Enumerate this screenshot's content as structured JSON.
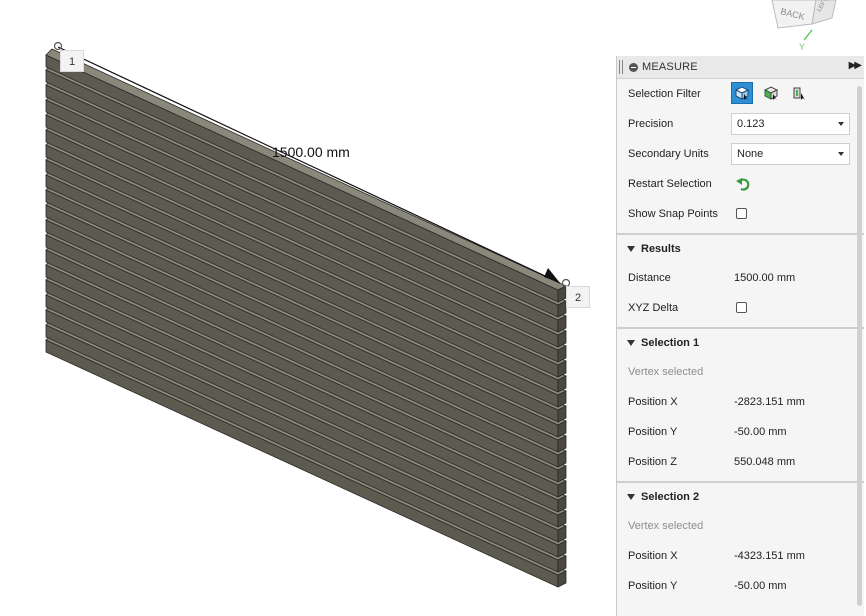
{
  "viewport": {
    "dimension_text": "1500.00 mm",
    "point1_label": "1",
    "point2_label": "2",
    "viewcube_back": "BACK",
    "viewcube_left": "LEFT",
    "axis_y": "Y"
  },
  "panel": {
    "title": "MEASURE",
    "selection_filter": {
      "label": "Selection Filter"
    },
    "precision": {
      "label": "Precision",
      "value": "0.123"
    },
    "secondary_units": {
      "label": "Secondary Units",
      "value": "None"
    },
    "restart_selection": {
      "label": "Restart Selection"
    },
    "show_snap_points": {
      "label": "Show Snap Points",
      "checked": false
    },
    "results": {
      "title": "Results",
      "distance_label": "Distance",
      "distance_value": "1500.00 mm",
      "xyz_delta_label": "XYZ Delta"
    },
    "selection1": {
      "title": "Selection 1",
      "status": "Vertex selected",
      "pos_x_label": "Position X",
      "pos_x": "-2823.151 mm",
      "pos_y_label": "Position Y",
      "pos_y": "-50.00 mm",
      "pos_z_label": "Position Z",
      "pos_z": "550.048 mm"
    },
    "selection2": {
      "title": "Selection 2",
      "status": "Vertex selected",
      "pos_x_label": "Position X",
      "pos_x": "-4323.151 mm",
      "pos_y_label": "Position Y",
      "pos_y": "-50.00 mm"
    }
  },
  "colors": {
    "slat_top": "#8a877b",
    "slat_front": "#5d5a50",
    "slat_edge": "#2a2925",
    "accent": "#2d8fd6",
    "restart_green": "#3a9a3a"
  }
}
